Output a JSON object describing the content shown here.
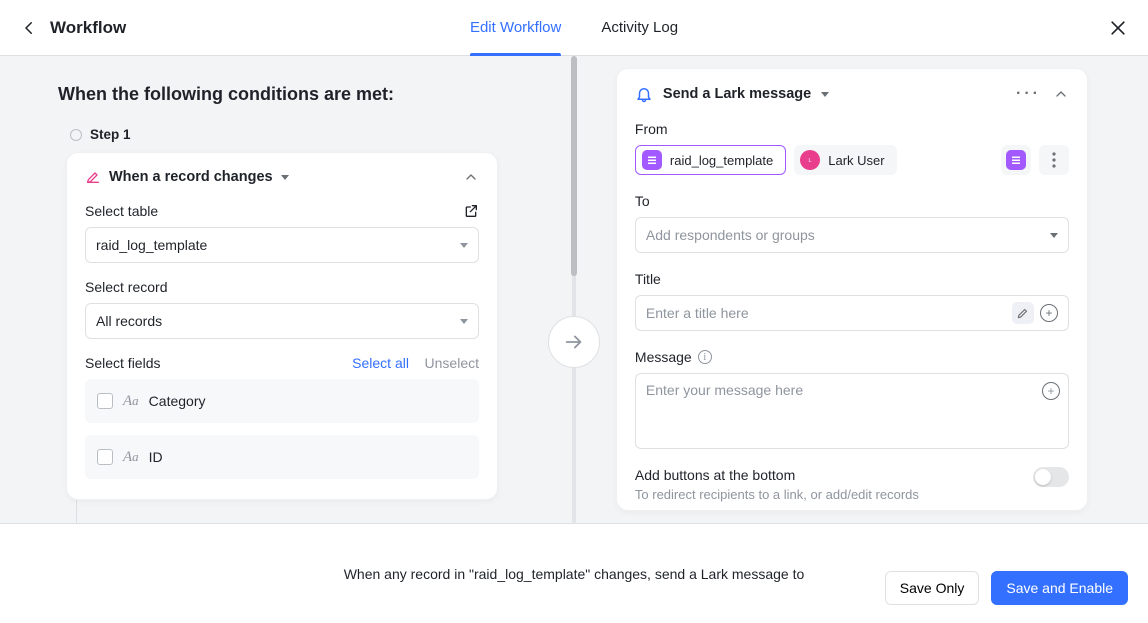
{
  "header": {
    "title": "Workflow",
    "tabs": [
      {
        "label": "Edit Workflow",
        "active": true
      },
      {
        "label": "Activity Log",
        "active": false
      }
    ]
  },
  "left": {
    "section_title": "When the following conditions are met:",
    "step_label": "Step 1",
    "trigger": {
      "title": "When a record changes",
      "table_label": "Select table",
      "table_value": "raid_log_template",
      "record_label": "Select record",
      "record_value": "All records",
      "fields_label": "Select fields",
      "select_all": "Select all",
      "unselect": "Unselect",
      "fields": [
        {
          "name": "Category"
        },
        {
          "name": "ID"
        }
      ]
    }
  },
  "right": {
    "title": "Send a Lark message",
    "from": {
      "label": "From",
      "primary_chip": "raid_log_template",
      "secondary_chip": "Lark User"
    },
    "to": {
      "label": "To",
      "placeholder": "Add respondents or groups"
    },
    "title_field": {
      "label": "Title",
      "placeholder": "Enter a title here"
    },
    "message": {
      "label": "Message",
      "placeholder": "Enter your message here"
    },
    "buttons_block": {
      "title": "Add buttons at the bottom",
      "subtitle": "To redirect recipients to a link, or add/edit records"
    }
  },
  "footer": {
    "summary": "When any record in \"raid_log_template\" changes, send a Lark message to",
    "save_only": "Save Only",
    "save_enable": "Save and Enable"
  }
}
